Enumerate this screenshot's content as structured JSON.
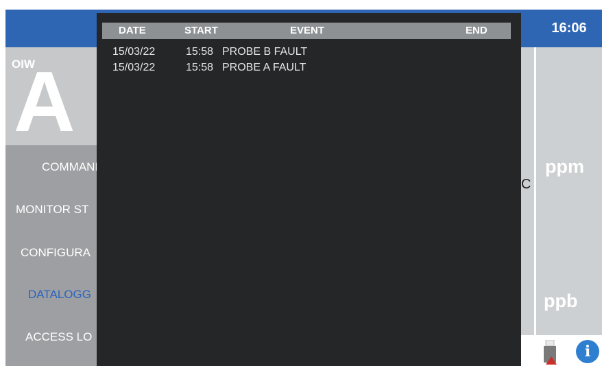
{
  "header": {
    "time": "16:06"
  },
  "left_panel": {
    "instrument_label": "OIW",
    "channel_letter": "A",
    "menu": [
      {
        "label": "COMMAND",
        "active": false
      },
      {
        "label": "MONITOR ST",
        "active": false
      },
      {
        "label": "CONFIGURA",
        "active": false
      },
      {
        "label": "DATALOGG",
        "active": true
      },
      {
        "label": "ACCESS LO",
        "active": false
      }
    ]
  },
  "right_panel": {
    "unit_top": "ppm",
    "unit_bottom": "ppb"
  },
  "event_log": {
    "columns": [
      "DATE",
      "START",
      "EVENT",
      "END"
    ],
    "rows": [
      {
        "date": "15/03/22",
        "start": "15:58",
        "event": "PROBE B FAULT",
        "end": ""
      },
      {
        "date": "15/03/22",
        "start": "15:58",
        "event": "PROBE A FAULT",
        "end": ""
      }
    ]
  },
  "status_icons": [
    "usb-drive-icon",
    "info-icon"
  ],
  "colors": {
    "topbar": "#2f66b3",
    "dialog": "#242628",
    "log_header": "#8d9193",
    "active_menu": "#2a63c0"
  }
}
